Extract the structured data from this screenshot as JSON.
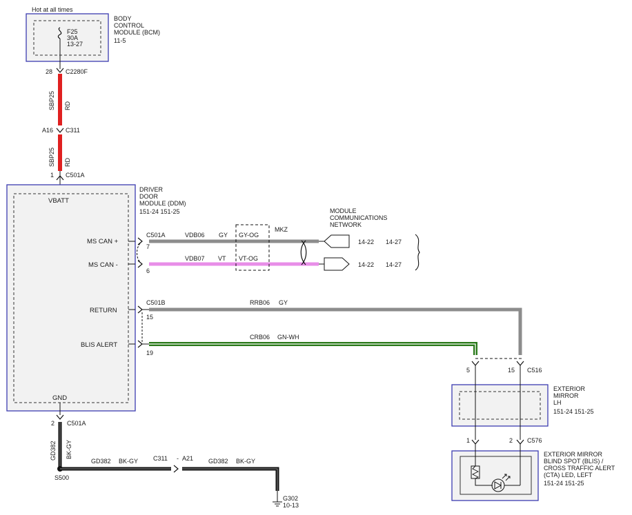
{
  "header": {
    "hot_label": "Hot at all times"
  },
  "bcm": {
    "name_lines": [
      "BODY",
      "CONTROL",
      "MODULE (BCM)"
    ],
    "ref": "11-5",
    "fuse": {
      "id": "F25",
      "rating": "30A",
      "ref": "13-27"
    }
  },
  "connectors": {
    "c2280f": {
      "pin": "28",
      "name": "C2280F"
    },
    "c311_top": {
      "pin": "A16",
      "name": "C311"
    },
    "c501a_top": {
      "pin": "1",
      "name": "C501A"
    },
    "c501a_bottom": {
      "pin": "2",
      "name": "C501A"
    },
    "c516": {
      "name": "C516",
      "pins": [
        "5",
        "15"
      ]
    },
    "c576": {
      "name": "C576",
      "pins": [
        "1",
        "2"
      ]
    },
    "c311_ground": {
      "name": "C311",
      "pin": "A21"
    }
  },
  "wires": {
    "sbp25_a": {
      "circuit": "SBP25",
      "color": "RD",
      "hex": "#e02020"
    },
    "sbp25_b": {
      "circuit": "SBP25",
      "color": "RD",
      "hex": "#e02020"
    },
    "vdb06": {
      "circuit": "VDB06",
      "color": "GY",
      "alt": "GY-OG",
      "hex": "#8c8c8c"
    },
    "vdb07": {
      "circuit": "VDB07",
      "color": "VT",
      "alt": "VT-OG",
      "hex": "#e88ee8"
    },
    "rrb06": {
      "circuit": "RRB06",
      "color": "GY",
      "hex": "#8c8c8c"
    },
    "crb06": {
      "circuit": "CRB06",
      "color": "GN-WH",
      "hex": "#2a7a1a"
    },
    "gd382_v": {
      "circuit": "GD382",
      "color": "BK-GY",
      "hex": "#111111"
    },
    "gd382_h1": {
      "circuit": "GD382",
      "color": "BK-GY"
    },
    "gd382_h2": {
      "circuit": "GD382",
      "color": "BK-GY"
    }
  },
  "ddm": {
    "name_lines": [
      "DRIVER",
      "DOOR",
      "MODULE (DDM)"
    ],
    "refs": "151-24  151-25",
    "pins": {
      "vbatt": "VBATT",
      "ms_can_plus": "MS CAN +",
      "ms_can_minus": "MS CAN -",
      "return": "RETURN",
      "blis_alert": "BLIS ALERT",
      "gnd": "GND"
    },
    "connector_a": "C501A",
    "connector_b": "C501B",
    "pin_numbers": {
      "can_plus": "7",
      "can_minus": "6",
      "return": "15",
      "blis": "19"
    }
  },
  "network": {
    "name_lines": [
      "MODULE",
      "COMMUNICATIONS",
      "NETWORK"
    ],
    "model_note": "MKZ",
    "refs_1": [
      "14-22",
      "14-27"
    ],
    "refs_2": [
      "14-22",
      "14-27"
    ]
  },
  "mirror": {
    "name_lines": [
      "EXTERIOR",
      "MIRROR",
      "LH"
    ],
    "refs": "151-24  151-25"
  },
  "blis": {
    "name_lines": [
      "EXTERIOR MIRROR",
      "BLIND SPOT (BLIS) /",
      "CROSS TRAFFIC ALERT",
      "(CTA) LED, LEFT"
    ],
    "refs": "151-24  151-25"
  },
  "splice": {
    "name": "S500"
  },
  "ground": {
    "name": "G302",
    "ref": "10-13"
  }
}
